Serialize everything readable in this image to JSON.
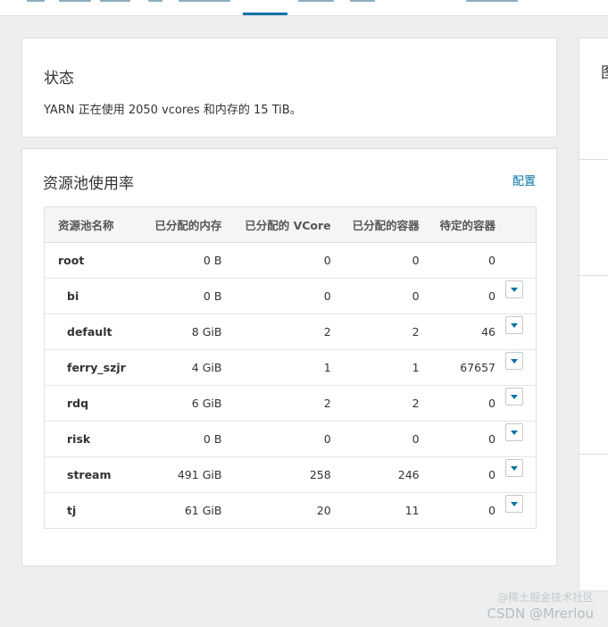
{
  "status": {
    "title": "状态",
    "message": "YARN 正在使用 2050 vcores 和内存的 15 TiB。"
  },
  "pools": {
    "title": "资源池使用率",
    "config_link": "配置",
    "columns": [
      "资源池名称",
      "已分配的内存",
      "已分配的 VCore",
      "已分配的容器",
      "待定的容器"
    ],
    "rows": [
      {
        "name": "root",
        "memory": "0 B",
        "vcore": "0",
        "containers": "0",
        "pending": "0",
        "child": false
      },
      {
        "name": "bi",
        "memory": "0 B",
        "vcore": "0",
        "containers": "0",
        "pending": "0",
        "child": true
      },
      {
        "name": "default",
        "memory": "8 GiB",
        "vcore": "2",
        "containers": "2",
        "pending": "46",
        "child": true
      },
      {
        "name": "ferry_szjr",
        "memory": "4 GiB",
        "vcore": "1",
        "containers": "1",
        "pending": "67657",
        "child": true
      },
      {
        "name": "rdq",
        "memory": "6 GiB",
        "vcore": "2",
        "containers": "2",
        "pending": "0",
        "child": true
      },
      {
        "name": "risk",
        "memory": "0 B",
        "vcore": "0",
        "containers": "0",
        "pending": "0",
        "child": true
      },
      {
        "name": "stream",
        "memory": "491 GiB",
        "vcore": "258",
        "containers": "246",
        "pending": "0",
        "child": true
      },
      {
        "name": "tj",
        "memory": "61 GiB",
        "vcore": "20",
        "containers": "11",
        "pending": "0",
        "child": true
      }
    ]
  },
  "side_panel": {
    "title": "图"
  },
  "watermark": {
    "line1": "@稀土掘金技术社区",
    "line2": "CSDN @Mrerlou"
  },
  "colors": {
    "accent": "#0a74a4",
    "background": "#eceeef"
  }
}
